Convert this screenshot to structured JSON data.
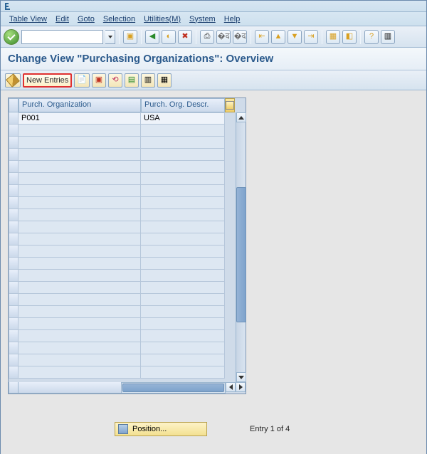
{
  "menu": {
    "table_view": "Table View",
    "edit": "Edit",
    "goto": "Goto",
    "selection": "Selection",
    "utilities": "Utilities(M)",
    "system": "System",
    "help": "Help"
  },
  "toolbar": {
    "command_value": ""
  },
  "page_title": "Change View \"Purchasing Organizations\": Overview",
  "app_toolbar": {
    "new_entries": "New Entries"
  },
  "table": {
    "col_org": "Purch. Organization",
    "col_desc": "Purch. Org. Descr.",
    "rows": [
      {
        "org": "P001",
        "desc": "USA"
      }
    ]
  },
  "footer": {
    "position_label": "Position...",
    "entry_text": "Entry 1 of 4"
  }
}
